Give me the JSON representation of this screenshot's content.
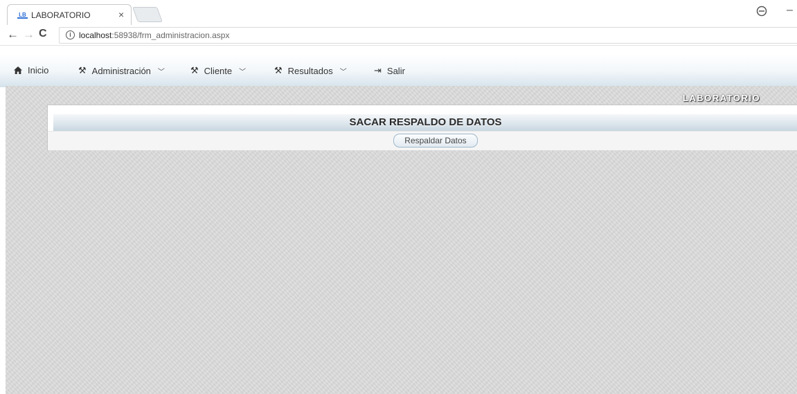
{
  "browser": {
    "tab": {
      "title": "LABORATORIO",
      "favicon_text": "LB",
      "close_glyph": "×"
    },
    "controls": {
      "back": "←",
      "forward": "→",
      "reload": "C",
      "minimize": "–"
    },
    "address": {
      "info_glyph": "i",
      "host": "localhost",
      "path": ":58938/frm_administracion.aspx"
    }
  },
  "menu": {
    "items": [
      {
        "label": "Inicio",
        "icon": "home-icon",
        "glyph": "🏠"
      },
      {
        "label": "Administración",
        "icon": "tools-icon",
        "glyph": "⚒",
        "chevron": "﹀"
      },
      {
        "label": "Cliente",
        "icon": "tools-icon",
        "glyph": "⚒",
        "chevron": "﹀"
      },
      {
        "label": "Resultados",
        "icon": "tools-icon",
        "glyph": "⚒",
        "chevron": "﹀"
      },
      {
        "label": "Salir",
        "icon": "log-out-icon",
        "glyph": "⇥"
      }
    ]
  },
  "brand": "LABORATORIO",
  "panel": {
    "title": "SACAR RESPALDO DE DATOS",
    "button_label": "Respaldar Datos"
  },
  "colors": {
    "menubar_gradient_end": "#d6e3ec",
    "content_bg": "#dcdcdc",
    "button_border": "#9fb7c9"
  }
}
